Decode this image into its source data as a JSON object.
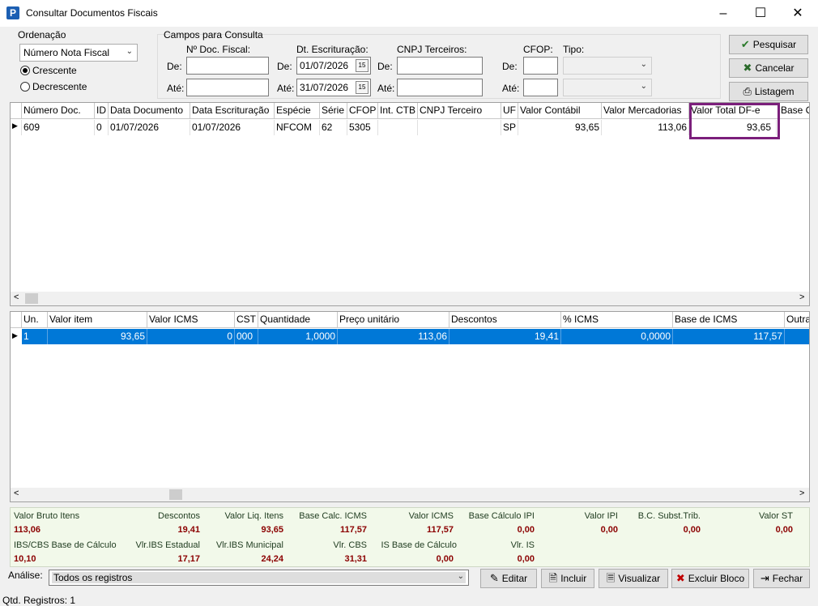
{
  "window": {
    "title": "Consultar Documentos Fiscais",
    "app_icon": "P"
  },
  "ordering": {
    "label": "Ordenação",
    "selected": "Número Nota Fiscal",
    "options": [
      "Crescente",
      "Decrescente"
    ],
    "selected_option": "Crescente"
  },
  "fields": {
    "group_label": "Campos para Consulta",
    "doc_label": "Nº Doc. Fiscal:",
    "dt_label": "Dt. Escrituração:",
    "cnpj_label": "CNPJ Terceiros:",
    "cfop_label": "CFOP:",
    "tipo_label": "Tipo:",
    "de": "De:",
    "ate": "Até:",
    "dt_from": "01/07/2026",
    "dt_to": "31/07/2026"
  },
  "buttons": {
    "pesquisar": "Pesquisar",
    "cancelar": "Cancelar",
    "listagem": "Listagem"
  },
  "docs_grid": {
    "headers": [
      "Número Doc.",
      "ID",
      "Data Documento",
      "Data Escrituração",
      "Espécie",
      "Série",
      "CFOP",
      "Int. CTB",
      "CNPJ Terceiro",
      "UF",
      "Valor Contábil",
      "Valor Mercadorias",
      "Valor Total DF-e",
      "Base C"
    ],
    "rows": [
      [
        "609",
        "0",
        "01/07/2026",
        "01/07/2026",
        "NFCOM",
        "62",
        "5305",
        "",
        "",
        "SP",
        "93,65",
        "113,06",
        "93,65",
        ""
      ]
    ],
    "highlight_color": "#7b1f7b"
  },
  "items_grid": {
    "headers": [
      "Un.",
      "Valor item",
      "Valor ICMS",
      "CST",
      "Quantidade",
      "Preço unitário",
      "Descontos",
      "% ICMS",
      "Base de ICMS",
      "Outra"
    ],
    "rows": [
      [
        "1",
        "93,65",
        "0",
        "000",
        "1,0000",
        "113,06",
        "19,41",
        "0,0000",
        "117,57",
        ""
      ]
    ],
    "selection_color": "#0078d7"
  },
  "totals": [
    {
      "label": "Valor Bruto Itens",
      "value": "113,06"
    },
    {
      "label": "Descontos",
      "value": "19,41"
    },
    {
      "label": "Valor Liq. Itens",
      "value": "93,65"
    },
    {
      "label": "Base Calc. ICMS",
      "value": "117,57"
    },
    {
      "label": "Valor ICMS",
      "value": "117,57"
    },
    {
      "label": "Base Cálculo IPI",
      "value": "0,00"
    },
    {
      "label": "Valor IPI",
      "value": "0,00"
    },
    {
      "label": "B.C. Subst.Trib.",
      "value": "0,00"
    },
    {
      "label": "Valor ST",
      "value": "0,00"
    },
    {
      "label": "IBS/CBS Base de Cálculo",
      "value": "10,10"
    },
    {
      "label": "Vlr.IBS Estadual",
      "value": "17,17"
    },
    {
      "label": "Vlr.IBS Municipal",
      "value": "24,24"
    },
    {
      "label": "Vlr. CBS",
      "value": "31,31"
    },
    {
      "label": "IS Base de Cálculo",
      "value": "0,00"
    },
    {
      "label": "Vlr. IS",
      "value": "0,00"
    }
  ],
  "analysis": {
    "label": "Análise:",
    "selected": "Todos os registros"
  },
  "bottom_buttons": {
    "editar": "Editar",
    "incluir": "Incluir",
    "visualizar": "Visualizar",
    "excluir": "Excluir Bloco",
    "fechar": "Fechar"
  },
  "status": "Qtd. Registros: 1"
}
